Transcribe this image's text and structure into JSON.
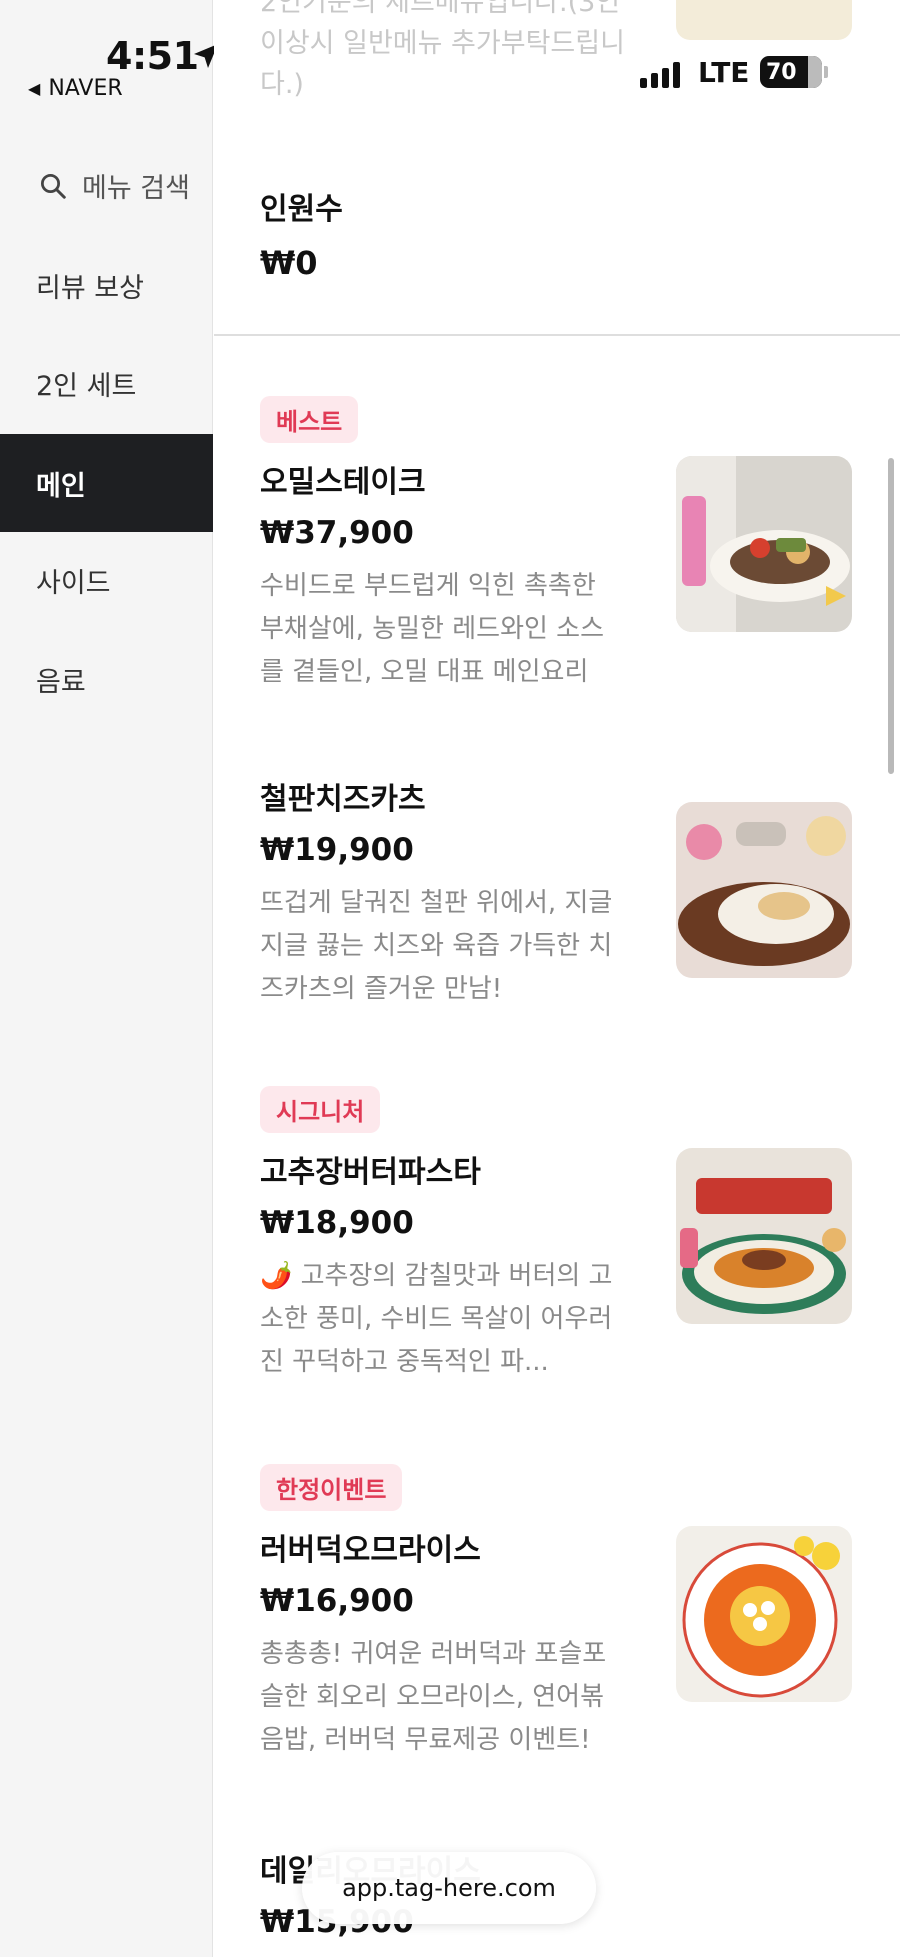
{
  "status": {
    "time": "4:51",
    "back_label": "NAVER",
    "network": "LTE",
    "battery": "70"
  },
  "sidebar": {
    "search_label": "메뉴 검색",
    "items": [
      {
        "label": "리뷰 보상"
      },
      {
        "label": "2인 세트"
      },
      {
        "label": "메인"
      },
      {
        "label": "사이드"
      },
      {
        "label": "음료"
      }
    ]
  },
  "set_section": {
    "desc_partial": "2인기준의 세트메뉴입니다.(3인이상시 일반메뉴 추가부탁드립니다.)",
    "people_label": "인원수",
    "people_price": "₩0"
  },
  "items": [
    {
      "badge": "베스트",
      "name": "오밀스테이크",
      "price": "₩37,900",
      "desc": "수비드로 부드럽게 익힌 촉촉한 부채살에, 농밀한 레드와인 소스를 곁들인, 오밀 대표 메인요리"
    },
    {
      "badge": "",
      "name": "철판치즈카츠",
      "price": "₩19,900",
      "desc": "뜨겁게 달궈진 철판 위에서, 지글지글 끓는 치즈와 육즙 가득한 치즈카츠의 즐거운 만남!"
    },
    {
      "badge": "시그니처",
      "name": "고추장버터파스타",
      "price": "₩18,900",
      "desc": "🌶️ 고추장의 감칠맛과 버터의 고소한 풍미, 수비드 목살이 어우러진 꾸덕하고 중독적인 파..."
    },
    {
      "badge": "한정이벤트",
      "name": "러버덕오므라이스",
      "price": "₩16,900",
      "desc": "총총총! 귀여운 러버덕과 포슬포슬한 회오리 오므라이스, 연어볶음밥, 러버덕 무료제공 이벤트!"
    },
    {
      "badge": "",
      "name": "데일리오므라이스",
      "price": "₩15,900",
      "desc": ""
    }
  ],
  "url_bar": {
    "url": "app.tag-here.com"
  },
  "colors": {
    "accent_badge_bg": "#fde8ec",
    "accent_badge_text": "#e03a55",
    "active_sidebar": "#1e1f22"
  }
}
